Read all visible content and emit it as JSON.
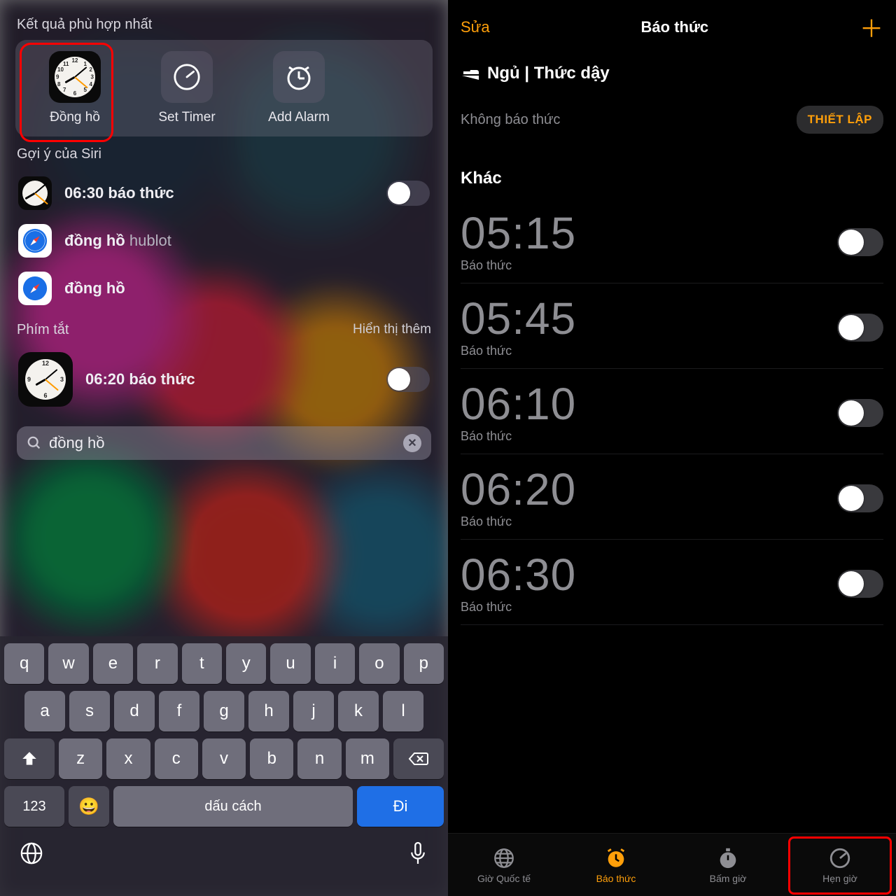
{
  "left": {
    "top_hits_title": "Kết quả phù hợp nhất",
    "top_hits": [
      {
        "label": "Đồng hồ",
        "icon": "clock-app-icon"
      },
      {
        "label": "Set Timer",
        "icon": "timer-icon"
      },
      {
        "label": "Add Alarm",
        "icon": "alarm-icon"
      }
    ],
    "siri_title": "Gợi ý của Siri",
    "siri_rows": [
      {
        "bold": "06:30",
        "rest": " báo thức",
        "toggle": false
      },
      {
        "bold": "đồng hồ",
        "rest": " hublot"
      },
      {
        "bold": "đồng hồ",
        "rest": ""
      }
    ],
    "shortcuts_title": "Phím tắt",
    "shortcuts_more": "Hiển thị thêm",
    "shortcut_row": {
      "bold": "06:20",
      "rest": " báo thức",
      "toggle": false
    },
    "search_value": "đồng hồ",
    "keyboard": {
      "row1": [
        "q",
        "w",
        "e",
        "r",
        "t",
        "y",
        "u",
        "i",
        "o",
        "p"
      ],
      "row2": [
        "a",
        "s",
        "d",
        "f",
        "g",
        "h",
        "j",
        "k",
        "l"
      ],
      "row3": [
        "z",
        "x",
        "c",
        "v",
        "b",
        "n",
        "m"
      ],
      "numbers": "123",
      "space": "dấu cách",
      "go": "Đi"
    }
  },
  "right": {
    "nav_edit": "Sửa",
    "nav_title": "Báo thức",
    "sleep_header": "Ngủ | Thức dậy",
    "sleep_none": "Không báo thức",
    "sleep_setup": "THIẾT LẬP",
    "other_header": "Khác",
    "alarms": [
      {
        "time": "05:15",
        "label": "Báo thức",
        "on": false
      },
      {
        "time": "05:45",
        "label": "Báo thức",
        "on": false
      },
      {
        "time": "06:10",
        "label": "Báo thức",
        "on": false
      },
      {
        "time": "06:20",
        "label": "Báo thức",
        "on": false
      },
      {
        "time": "06:30",
        "label": "Báo thức",
        "on": false
      }
    ],
    "tabs": [
      {
        "label": "Giờ Quốc tế",
        "icon": "globe-icon"
      },
      {
        "label": "Báo thức",
        "icon": "alarm-icon",
        "active": true
      },
      {
        "label": "Bấm giờ",
        "icon": "stopwatch-icon"
      },
      {
        "label": "Hẹn giờ",
        "icon": "timer-icon",
        "highlight": true
      }
    ]
  }
}
